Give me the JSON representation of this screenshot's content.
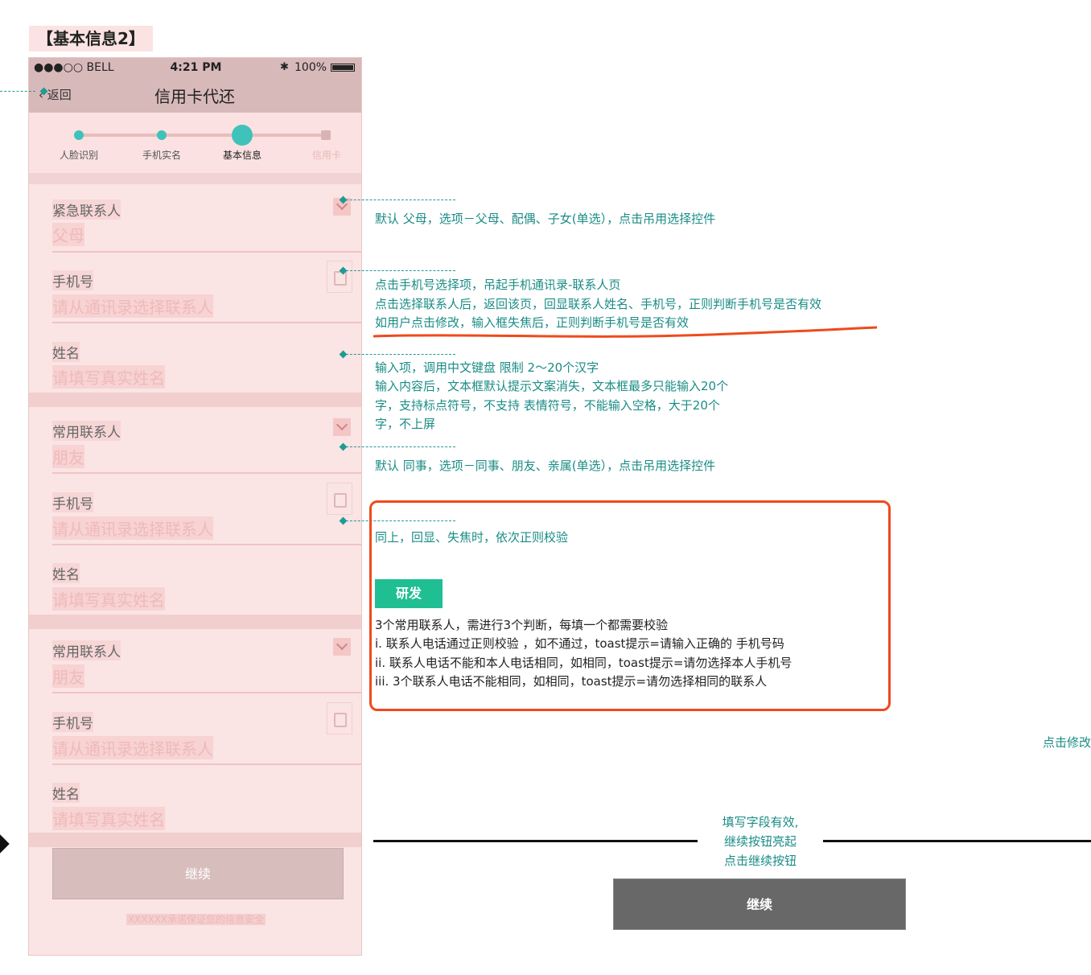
{
  "page_title": "【基本信息2】",
  "status_bar": {
    "carrier": "●●●○○ BELL",
    "time": "4:21 PM",
    "battery": "100%"
  },
  "nav": {
    "back": "返回",
    "title": "信用卡代还"
  },
  "steps": [
    "人脸识别",
    "手机实名",
    "基本信息",
    "信用卡"
  ],
  "form": {
    "groups": [
      {
        "relation_label": "紧急联系人",
        "relation_value": "父母",
        "phone_label": "手机号",
        "phone_placeholder": "请从通讯录选择联系人",
        "name_label": "姓名",
        "name_placeholder": "请填写真实姓名"
      },
      {
        "relation_label": "常用联系人",
        "relation_value": "朋友",
        "phone_label": "手机号",
        "phone_placeholder": "请从通讯录选择联系人",
        "name_label": "姓名",
        "name_placeholder": "请填写真实姓名"
      },
      {
        "relation_label": "常用联系人",
        "relation_value": "朋友",
        "phone_label": "手机号",
        "phone_placeholder": "请从通讯录选择联系人",
        "name_label": "姓名",
        "name_placeholder": "请填写真实姓名"
      }
    ],
    "continue": "继续",
    "security_note": "XXXXXX承诺保证您的信息安全"
  },
  "annotations": {
    "relation_default": "默认 父母，选项－父母、配偶、子女(单选），点击吊用选择控件",
    "phone_lines": [
      "点击手机号选择项，吊起手机通讯录-联系人页",
      "点击选择联系人后，返回该页，回显联系人姓名、手机号，正则判断手机号是否有效",
      "如用户点击修改，输入框失焦后，正则判断手机号是否有效"
    ],
    "name_lines": [
      "输入项，调用中文键盘 限制 2～20个汉字",
      "输入内容后，文本框默认提示文案消失，文本框最多只能输入20个",
      "字，支持标点符号，不支持  表情符号，不能输入空格，大于20个",
      "字，不上屏"
    ],
    "relation2_default": "默认 同事，选项－同事、朋友、亲属(单选），点击吊用选择控件",
    "same_as_above": "同上，回显、失焦时，依次正则校验",
    "dev_badge": "研发",
    "dev_lines": [
      "3个常用联系人，需进行3个判断，每填一个都需要校验",
      "i.     联系人电话通过正则校验 ，如不通过，toast提示=请输入正确的 手机号码",
      "ii.     联系人电话不能和本人电话相同，如相同，toast提示=请勿选择本人手机号",
      "iii.     3个联系人电话不能相同，如相同，toast提示=请勿选择相同的联系人"
    ],
    "edge_note": "点击修改",
    "flow_lines": [
      "填写字段有效,",
      "继续按钮亮起",
      "点击继续按钮"
    ],
    "continue_active": "继续"
  },
  "colors": {
    "accent": "#3fc2b9",
    "annotation": "#1a8c85",
    "highlight": "#f04a1c",
    "dev_badge": "#1fbf93"
  }
}
